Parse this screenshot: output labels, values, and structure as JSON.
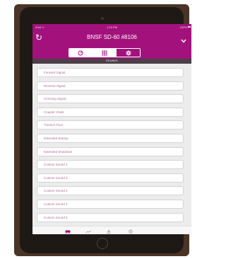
{
  "colors": {
    "accent": "#a3127c",
    "section_bar": "#4b4048",
    "item_text": "#b56b9a",
    "screen_bg": "#ececec",
    "bezel": "#1f1915",
    "case": "#4a3426"
  },
  "status_bar": {
    "left": "iPad ᯤ",
    "time": "1:23 PM",
    "right": "100%"
  },
  "nav": {
    "title": "BNSF SD-60 #8106",
    "refresh_icon": "refresh-icon",
    "menu_icon": "chevron-down-icon"
  },
  "segments": [
    {
      "icon": "speedometer-icon",
      "selected": false
    },
    {
      "icon": "keypad-grid-icon",
      "selected": false
    },
    {
      "icon": "gear-icon",
      "selected": true
    }
  ],
  "section": {
    "title": "SOUNDS"
  },
  "sounds": [
    "Forward Signal",
    "Reverse Signal",
    "Crossing Signal",
    "Coupler Clank",
    "Traction Fixer",
    "Extended Startup",
    "Extended Shutdown",
    "Custom Sound 1",
    "Custom Sound 2",
    "Custom Sound 3",
    "Custom Sound 4",
    "Custom Sound 5"
  ],
  "tabs": [
    {
      "icon": "train-icon",
      "active": true
    },
    {
      "icon": "chart-icon",
      "active": false
    },
    {
      "icon": "tools-icon",
      "active": false
    },
    {
      "icon": "settings-icon",
      "active": false
    }
  ]
}
